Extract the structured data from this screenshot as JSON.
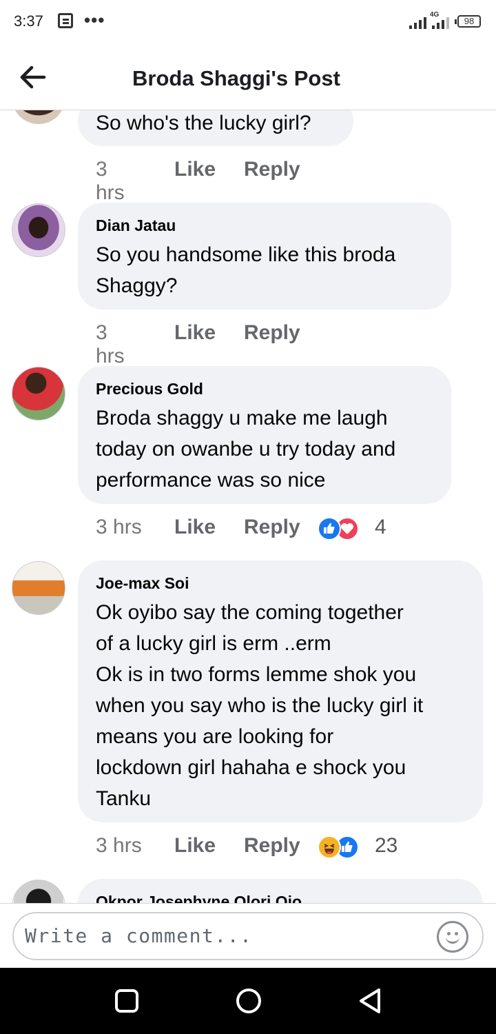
{
  "status_bar": {
    "time": "3:37",
    "network": "4G",
    "battery": "98"
  },
  "header": {
    "title": "Broda Shaggi's Post"
  },
  "comments": [
    {
      "author": "",
      "text": "So who's the lucky girl?",
      "time": "3 hrs",
      "like_label": "Like",
      "reply_label": "Reply",
      "reactions": [],
      "reaction_count": ""
    },
    {
      "author": "Dian Jatau",
      "text": "So you handsome like this broda\nShaggy?",
      "time": "3 hrs",
      "like_label": "Like",
      "reply_label": "Reply",
      "reactions": [],
      "reaction_count": ""
    },
    {
      "author": "Precious Gold",
      "text": "Broda shaggy u make me laugh\ntoday on owanbe u try today and\nperformance was so nice",
      "time": "3 hrs",
      "like_label": "Like",
      "reply_label": "Reply",
      "reactions": [
        "like-icon",
        "love-icon"
      ],
      "reaction_count": "4"
    },
    {
      "author": "Joe-max Soi",
      "text": "Ok oyibo say the coming together\nof a lucky girl is erm ..erm\nOk is in two forms lemme shok you\nwhen you say who is the lucky girl it\nmeans you are looking for\nlockdown girl hahaha e shock you\nTanku",
      "time": "3 hrs",
      "like_label": "Like",
      "reply_label": "Reply",
      "reactions": [
        "haha-icon",
        "like-icon"
      ],
      "reaction_count": "23"
    },
    {
      "author": "Okpor Josephyne Olori Ojo",
      "text": "",
      "time": "",
      "like_label": "",
      "reply_label": "",
      "reactions": [],
      "reaction_count": ""
    }
  ],
  "composer": {
    "placeholder": "Write a comment..."
  },
  "colors": {
    "like_blue": "#1877f2",
    "love_red": "#f33e58",
    "haha_yellow": "#f7b125",
    "bubble_gray": "#f0f2f5",
    "meta_gray": "#65676b"
  }
}
